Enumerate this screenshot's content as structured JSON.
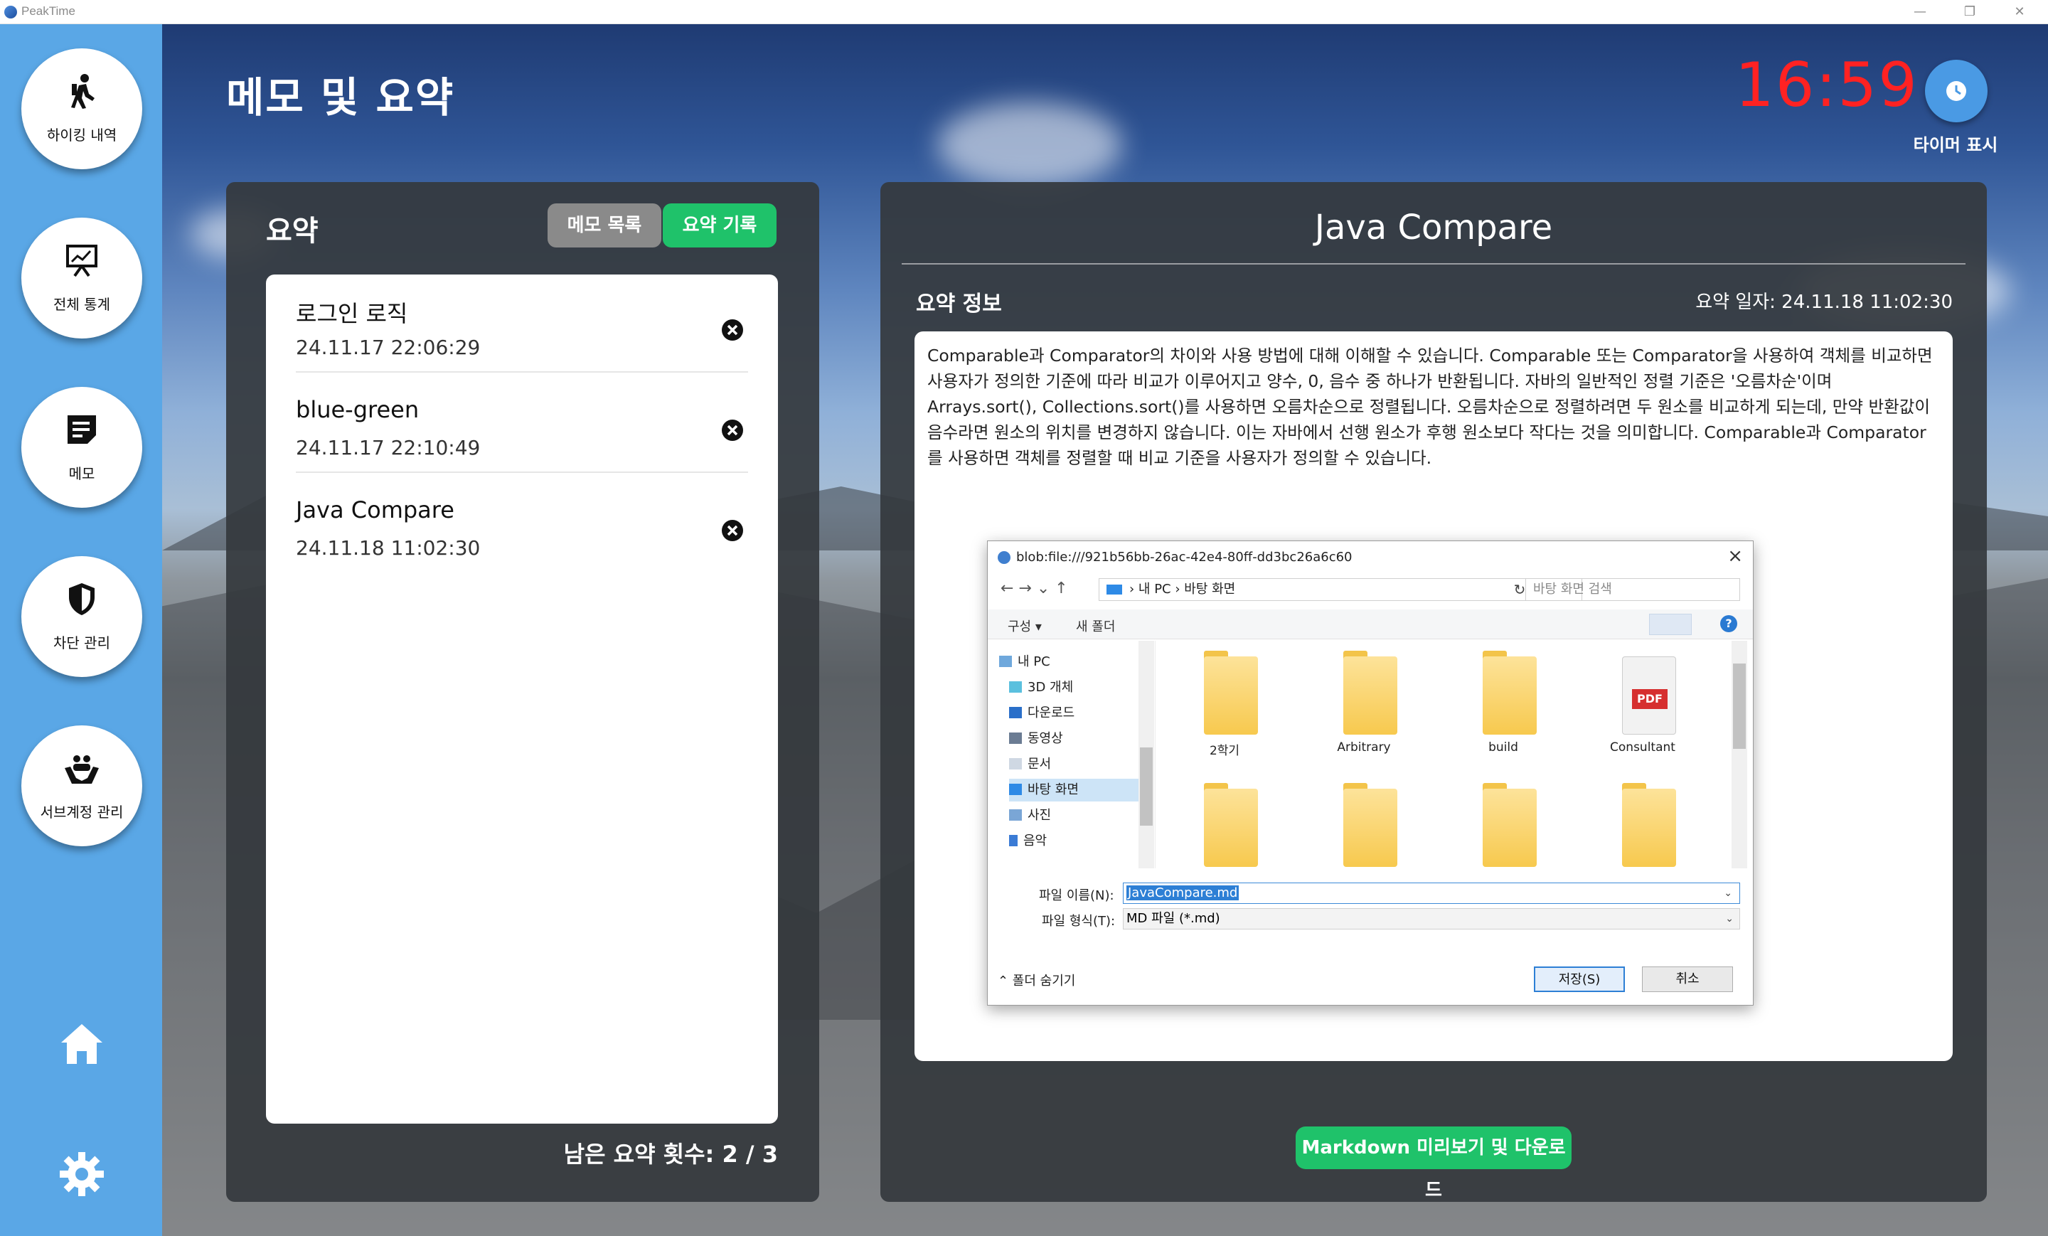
{
  "window": {
    "app_title": "PeakTime",
    "controls": {
      "minimize": "—",
      "restore": "❐",
      "close": "✕"
    }
  },
  "sidebar": {
    "items": [
      {
        "label": "하이킹 내역",
        "icon": "hiker-icon"
      },
      {
        "label": "전체 통계",
        "icon": "chart-board-icon"
      },
      {
        "label": "메모",
        "icon": "memo-icon"
      },
      {
        "label": "차단 관리",
        "icon": "shield-icon"
      },
      {
        "label": "서브계정 관리",
        "icon": "people-hands-icon"
      }
    ],
    "bottom": {
      "home_icon": "home-icon",
      "settings_icon": "gear-icon"
    }
  },
  "header": {
    "title": "메모 및 요약",
    "clock": "16:59",
    "timer_label": "타이머 표시"
  },
  "left_panel": {
    "title": "요약",
    "tabs": [
      {
        "label": "메모 목록",
        "active": false
      },
      {
        "label": "요약 기록",
        "active": true
      }
    ],
    "items": [
      {
        "title": "로그인 로직",
        "date": "24.11.17 22:06:29"
      },
      {
        "title": "blue-green",
        "date": "24.11.17 22:10:49"
      },
      {
        "title": "Java Compare",
        "date": "24.11.18 11:02:30"
      }
    ],
    "remaining": "남은 요약 횟수: 2 / 3"
  },
  "right_panel": {
    "title": "Java Compare",
    "info_label": "요약 정보",
    "info_date": "요약 일자: 24.11.18 11:02:30",
    "content": "Comparable과 Comparator의 차이와 사용 방법에 대해 이해할 수 있습니다. Comparable 또는 Comparator을 사용하여 객체를 비교하면 사용자가 정의한 기준에 따라 비교가 이루어지고 양수, 0, 음수 중 하나가 반환됩니다. 자바의 일반적인 정렬 기준은 '오름차순'이며 Arrays.sort(), Collections.sort()를 사용하면 오름차순으로 정렬됩니다. 오름차순으로 정렬하려면 두 원소를 비교하게 되는데, 만약 반환값이 음수라면 원소의 위치를 변경하지 않습니다. 이는 자바에서 선행 원소가 후행 원소보다 작다는 것을 의미합니다. Comparable과 Comparator를 사용하면 객체를 정렬할 때 비교 기준을 사용자가 정의할 수 있습니다.",
    "download_button": "Markdown 미리보기 및 다운로드"
  },
  "save_dialog": {
    "title": "blob:file:///921b56bb-26ac-42e4-80ff-dd3bc26a6c60",
    "nav": "←  →  ⌄  ↑",
    "address": "› 내 PC › 바탕 화면",
    "search_placeholder": "바탕 화면 검색",
    "toolbar": {
      "organize": "구성 ▾",
      "new_folder": "새 폴더",
      "help": "?"
    },
    "tree": [
      {
        "label": "내 PC",
        "selected": false
      },
      {
        "label": "3D 개체",
        "selected": false
      },
      {
        "label": "다운로드",
        "selected": false
      },
      {
        "label": "동영상",
        "selected": false
      },
      {
        "label": "문서",
        "selected": false
      },
      {
        "label": "바탕 화면",
        "selected": true
      },
      {
        "label": "사진",
        "selected": false
      },
      {
        "label": "음악",
        "selected": false
      }
    ],
    "files": [
      {
        "label": "2학기",
        "type": "folder"
      },
      {
        "label": "Arbitrary",
        "type": "folder"
      },
      {
        "label": "build",
        "type": "folder"
      },
      {
        "label": "Consultant",
        "type": "pdf"
      }
    ],
    "pdf_badge": "PDF",
    "filename_label": "파일 이름(N):",
    "filename_value": "JavaCompare.md",
    "filetype_label": "파일 형식(T):",
    "filetype_value": "MD 파일 (*.md)",
    "hide_folders": "⌃ 폴더 숨기기",
    "save_button": "저장(S)",
    "cancel_button": "취소"
  }
}
